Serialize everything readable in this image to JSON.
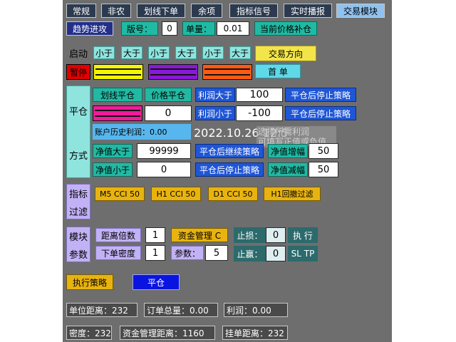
{
  "tabs": [
    {
      "label": "常规"
    },
    {
      "label": "非农"
    },
    {
      "label": "划线下单"
    },
    {
      "label": "余项"
    },
    {
      "label": "指标信号"
    },
    {
      "label": "实时播报"
    },
    {
      "label": "交易模块"
    }
  ],
  "row1": {
    "trend_btn": "趋势进攻",
    "version_label": "版号：",
    "version_value": "0",
    "lot_label": "单量：",
    "lot_value": "0.01",
    "refill_btn": "当前价格补仓"
  },
  "start": {
    "start_label": "启动",
    "pause_btn": "暂停",
    "lt_gt": [
      "小于",
      "大于",
      "小于",
      "大于",
      "小于",
      "大于"
    ],
    "direction_btn": "交易方向",
    "first_btn": "首 单",
    "swatch_colors": [
      "#f5f500",
      "#8a18d8",
      "#ff5a12"
    ]
  },
  "close": {
    "side_label_top": "平仓",
    "side_label_bottom": "方式",
    "line_close_btn": "划线平仓",
    "price_close_btn": "价格平仓",
    "profit_gt_label": "利润大于",
    "profit_gt_value": "100",
    "stop_after_close_1": "平仓后停止策略",
    "swatch_color": "#f21a9c",
    "zero_value": "0",
    "profit_lt_label": "利润小于",
    "profit_lt_value": "-100",
    "stop_after_close_2": "平仓后停止策略",
    "history_profit": "账户历史利润：0.00",
    "datetime": "2022.10.26 12:57",
    "overlay_line1": "选择所需利润",
    "overlay_line2": "可填写正值或负值",
    "equity_gt_label": "净值大于",
    "equity_gt_value": "99999",
    "continue_after_close": "平仓后继续策略",
    "equity_inc_label": "净值增幅",
    "equity_inc_value": "50",
    "equity_lt_label": "净值小于",
    "equity_lt_value": "0",
    "stop_after_close_3": "平仓后停止策略",
    "equity_dec_label": "净值减幅",
    "equity_dec_value": "50"
  },
  "indicator": {
    "side_label_top": "指标",
    "side_label_bottom": "过滤",
    "filters": [
      "M5 CCI 50",
      "H1 CCI 50",
      "D1 CCI 50",
      "H1回撤过滤"
    ]
  },
  "module": {
    "side_label_top": "模块",
    "side_label_bottom": "参数",
    "distance_mult_label": "距离倍数",
    "distance_mult_value": "1",
    "money_mgmt": "资金管理 C",
    "stop_loss_label": "止损：",
    "stop_loss_value": "0",
    "execute_label": "执 行",
    "order_density_label": "下单密度",
    "order_density_value": "1",
    "param_label": "参数：",
    "param_value": "5",
    "take_profit_label": "止赢：",
    "take_profit_value": "0",
    "sltp_label": "SL TP"
  },
  "actions": {
    "execute_strategy": "执行策略",
    "close_position": "平仓"
  },
  "stats": {
    "unit_distance": "单位距离：232",
    "order_total": "订单总量：0.00",
    "profit": "利润：0.00",
    "density": "密度：232",
    "money_mgmt_distance": "资金管理距离：1160",
    "pending_distance": "挂单距离：232"
  }
}
